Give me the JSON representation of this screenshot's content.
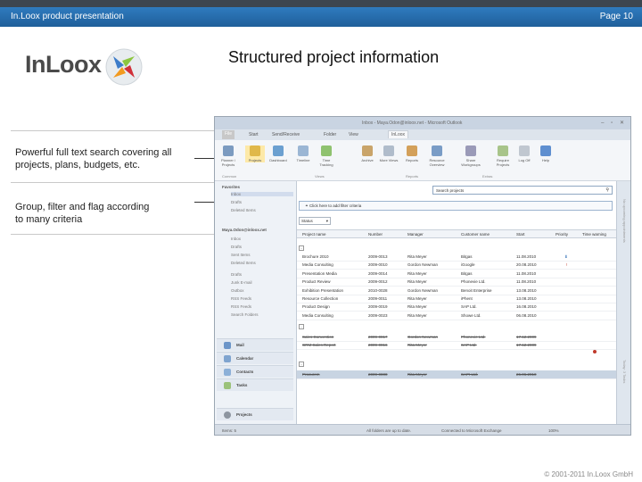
{
  "slide": {
    "header_left": "In.Loox product presentation",
    "header_right": "Page 10",
    "title": "Structured project information",
    "bullet1": "Powerful full text search covering all projects, plans, budgets, etc.",
    "bullet2": "Group, filter and flag according to many criteria",
    "footer": "© 2001-2011 In.Loox GmbH",
    "logo_text": "InLoox"
  },
  "colors": {
    "header_blue": "#2a6fb0",
    "logo_orange": "#f29a1f",
    "logo_green": "#8cc63f",
    "logo_blue": "#3d7cc9",
    "logo_red": "#d0313a"
  },
  "app": {
    "window_title": "Inbox - Maya.Odon@inloox.net - Microsoft Outlook",
    "tabs": [
      "File",
      "Start",
      "Send/Receive",
      "Folder",
      "View",
      "InLoox"
    ],
    "ribbon_buttons": [
      "Planner / Projects",
      "Projects",
      "Dashboard",
      "Timeline",
      "Time Tracking",
      "Archive",
      "More Views",
      "Reports",
      "Resource Overview",
      "Share Workgroups",
      "Require Projects",
      "Log Off",
      "Help"
    ],
    "ribbon_groups": [
      "Common",
      "Views",
      "Reports",
      "Extras"
    ],
    "nav": {
      "favorites": "Favorites",
      "fav_items": [
        "Inbox",
        "Drafts",
        "Deleted Items"
      ],
      "account": "Maya.Odon@inloox.net",
      "account_items": [
        "Inbox",
        "Drafts",
        "Sent Items",
        "Deleted Items",
        "Drafts",
        "Junk E-mail",
        "Outbox",
        "RSS Feeds",
        "RSS Feeds",
        "Search Folders"
      ],
      "bottom": [
        "Mail",
        "Calendar",
        "Contacts",
        "Tasks",
        "Projects"
      ]
    },
    "search_placeholder": "Search projects",
    "filter_label": "Click here to add filter criteria",
    "status_dropdown": "Status",
    "columns": [
      "Project name",
      "Number",
      "Manager",
      "Customer name",
      "Start",
      "Priority",
      "Time warning"
    ],
    "rows": [
      {
        "name": "Brochure 2010",
        "number": "2009-0013",
        "manager": "Rita Meyer",
        "customer": "Bitgas",
        "start": "11.08.2010"
      },
      {
        "name": "Media Consulting",
        "number": "2009-0010",
        "manager": "Gordon Newman",
        "customer": "iGoogle",
        "start": "20.08.2010"
      },
      {
        "name": "Presentation Media",
        "number": "2009-0014",
        "manager": "Rita Meyer",
        "customer": "Bitgas",
        "start": "11.08.2010"
      },
      {
        "name": "Product Review",
        "number": "2009-0012",
        "manager": "Rita Meyer",
        "customer": "Phonevie Ltd.",
        "start": "11.08.2010"
      },
      {
        "name": "Exhibition Presentation",
        "number": "2010-0028",
        "manager": "Gordon Newman",
        "customer": "Benoit Enterprise",
        "start": "13.08.2010"
      },
      {
        "name": "Resource Collection",
        "number": "2009-0011",
        "manager": "Rita Meyer",
        "customer": "iPhent",
        "start": "13.08.2010"
      },
      {
        "name": "Product Design",
        "number": "2009-0019",
        "manager": "Rita Meyer",
        "customer": "SAP Ltd.",
        "start": "16.08.2010"
      },
      {
        "name": "Media Consulting",
        "number": "2009-0023",
        "manager": "Rita Meyer",
        "customer": "Showe Ltd.",
        "start": "06.08.2010"
      }
    ],
    "struck_rows": [
      {
        "name": "Sales Convention",
        "number": "2009-0017",
        "manager": "Gordon Newman",
        "customer": "Phonevie Ltd.",
        "start": "17.12.2009"
      },
      {
        "name": "CRM Sales Report",
        "number": "2009-0016",
        "manager": "Rita Meyer",
        "customer": "SAP Ltd.",
        "start": "17.12.2009"
      }
    ],
    "selected_row": {
      "name": "Procurem",
      "number": "2009-0000",
      "manager": "Rita Meyer",
      "customer": "SAPI Ltd.",
      "start": "26.06.2010"
    },
    "side_strip": [
      "No upcoming appointments",
      "Today: 3 Tasks"
    ],
    "status_left": "Items: 5",
    "status_mid": "All folders are up to date.",
    "status_conn": "Connected to Microsoft Exchange",
    "zoom": "100%"
  }
}
